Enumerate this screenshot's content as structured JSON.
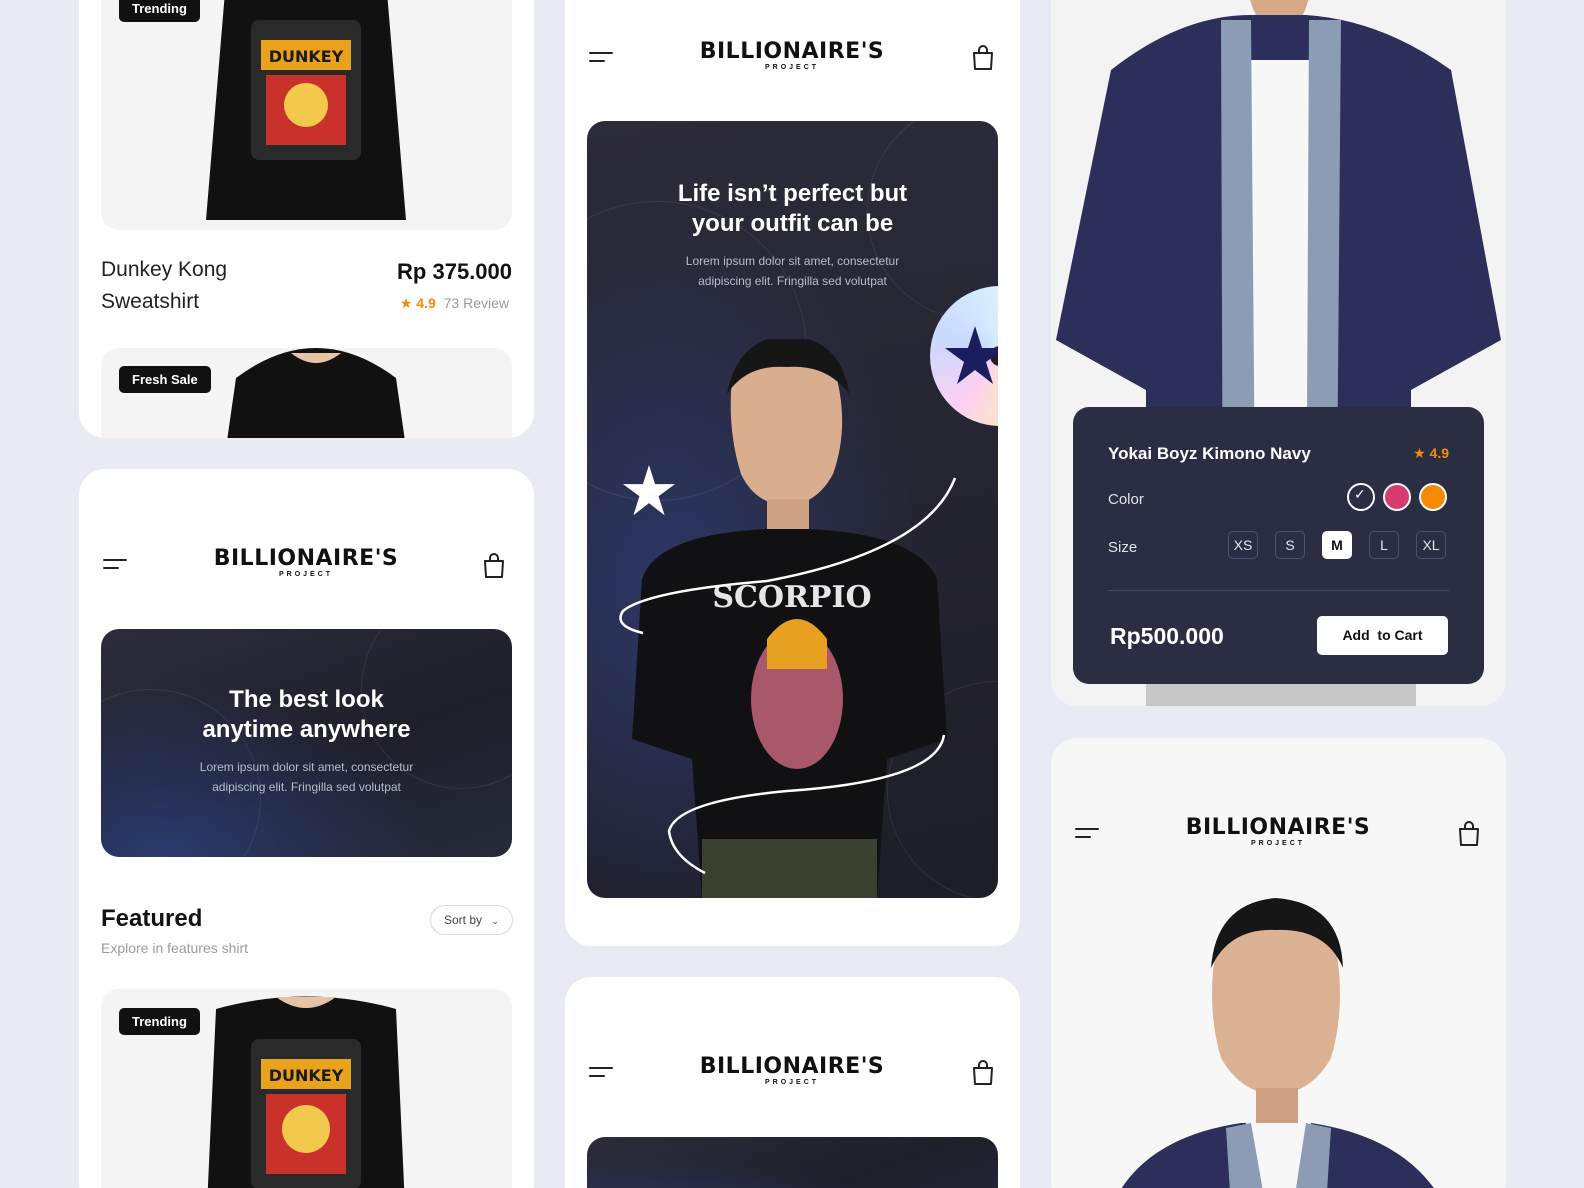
{
  "brand": {
    "name": "BILLIONAIRE'S",
    "sub": "PROJECT"
  },
  "product_top": {
    "badge": "Trending",
    "name_line1": "Dunkey Kong",
    "name_line2": "Sweatshirt",
    "price": "Rp 375.000",
    "rating": "4.9",
    "reviews": "73 Review",
    "next_badge": "Fresh Sale"
  },
  "home_screen": {
    "hero_title_line1": "The best look",
    "hero_title_line2": "anytime anywhere",
    "hero_sub_line1": "Lorem ipsum dolor sit amet, consectetur",
    "hero_sub_line2": "adipiscing elit. Fringilla sed volutpat",
    "featured_title": "Featured",
    "featured_sub": "Explore in features shirt",
    "sort_label": "Sort by",
    "featured_badge": "Trending"
  },
  "center_screen": {
    "hero_title_line1": "Life isn’t perfect but",
    "hero_title_line2": "your outfit can be",
    "hero_sub_line1": "Lorem ipsum dolor sit amet, consectetur",
    "hero_sub_line2": "adipiscing elit. Fringilla sed volutpat",
    "shirt_print": "SCORPIO"
  },
  "detail_screen": {
    "product_name": "Yokai Boyz Kimono Navy",
    "rating": "4.9",
    "color_label": "Color",
    "size_label": "Size",
    "sizes": [
      "XS",
      "S",
      "M",
      "L",
      "XL"
    ],
    "selected_size": "M",
    "colors": [
      "#2b2d42",
      "#d63c6e",
      "#f58a07"
    ],
    "price": "Rp500.000",
    "cta": "Add  to Cart"
  },
  "colors": {
    "accent": "#f58a07",
    "dark": "#2b2d42",
    "background": "#e8ebf4"
  }
}
